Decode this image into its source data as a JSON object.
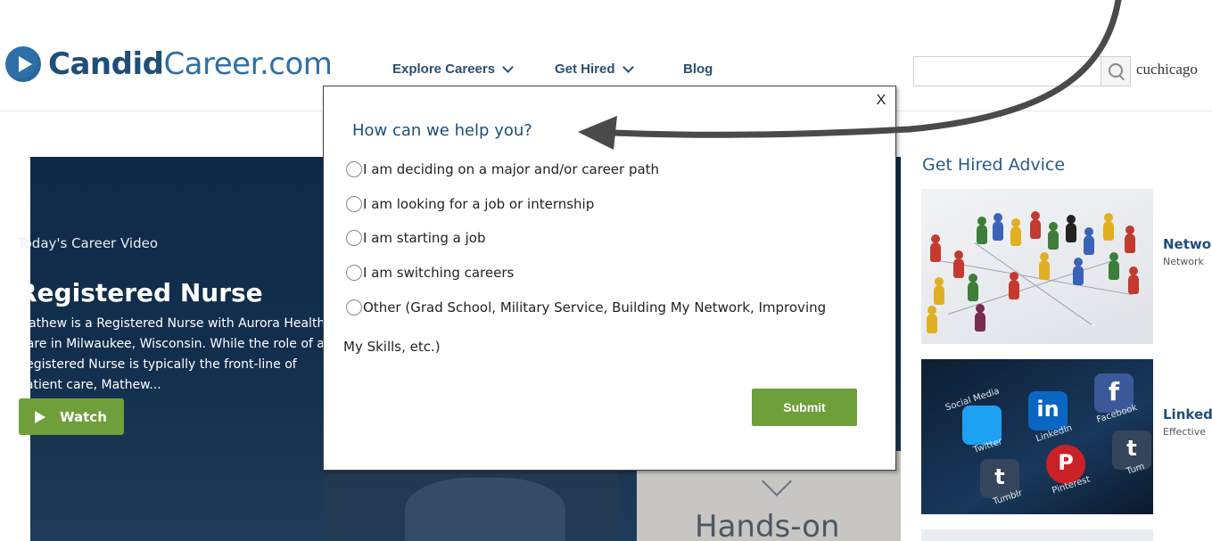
{
  "header": {
    "logo_primary": "Candid",
    "logo_secondary": "Career.com",
    "nav": [
      {
        "label": "Explore Careers",
        "has_dropdown": true
      },
      {
        "label": "Get Hired",
        "has_dropdown": true
      },
      {
        "label": "Blog",
        "has_dropdown": false
      }
    ],
    "search": {
      "value": "",
      "placeholder": ""
    },
    "user": "cuchicago"
  },
  "hero": {
    "kicker": "Today's Career Video",
    "title": "Registered Nurse",
    "description": "Mathew is a Registered Nurse with Aurora Health Care in Milwaukee, Wisconsin. While the role of a Registered Nurse is typically the front-line of patient care, Mathew...",
    "watch_label": "Watch",
    "poster_text": "Hands-on"
  },
  "sidebar": {
    "title": "Get Hired Advice",
    "articles": [
      {
        "title": "Netwo",
        "subtitle": "Network"
      },
      {
        "title": "Linked",
        "subtitle": "Effective"
      }
    ],
    "social_tiles": [
      {
        "name": "Twitter",
        "color": "#1da1f2",
        "glyph": "🐦"
      },
      {
        "name": "LinkedIn",
        "color": "#0a66c2",
        "glyph": "in"
      },
      {
        "name": "Facebook",
        "color": "#3b5998",
        "glyph": "f"
      },
      {
        "name": "Tumblr",
        "color": "#35465c",
        "glyph": "t"
      },
      {
        "name": "Pinterest",
        "color": "#cb2027",
        "glyph": "P"
      },
      {
        "name": "Tum",
        "color": "#35465c",
        "glyph": "t"
      }
    ],
    "social_banner": "Social Media"
  },
  "modal": {
    "close_label": "X",
    "title": "How can we help you?",
    "options": [
      "I am deciding on a major and/or career path",
      "I am looking for a job or internship",
      "I am starting a job",
      "I am switching careers",
      "Other (Grad School, Military Service, Building My Network, Improving"
    ],
    "option_wrap": "My Skills, etc.)",
    "submit_label": "Submit"
  },
  "colors": {
    "brand_dark": "#1f4e79",
    "brand": "#2f6fa8",
    "accent_green": "#6e9f3a",
    "arrow": "#4a4a4a"
  }
}
